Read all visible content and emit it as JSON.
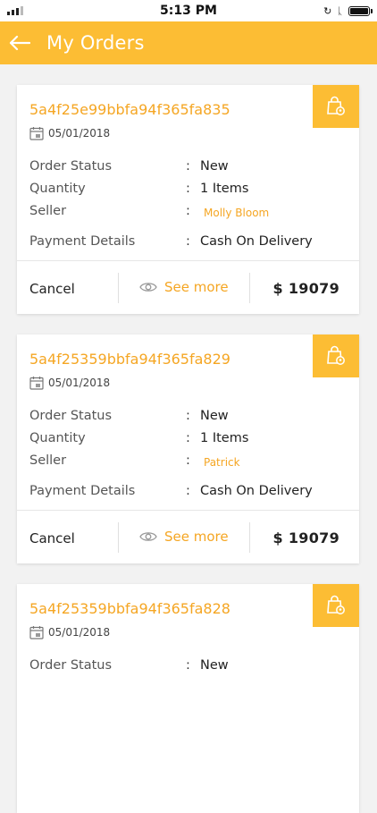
{
  "status_bar": {
    "time": "5:13 PM"
  },
  "header": {
    "title": "My Orders"
  },
  "labels": {
    "order_status": "Order Status",
    "quantity": "Quantity",
    "seller": "Seller",
    "payment": "Payment Details",
    "colon": ":",
    "cancel": "Cancel",
    "see_more": "See more"
  },
  "orders": [
    {
      "id": "5a4f25e99bbfa94f365fa835",
      "date": "05/01/2018",
      "status": "New",
      "quantity": "1 Items",
      "seller": "Molly Bloom",
      "payment": "Cash On Delivery",
      "price": "$ 19079"
    },
    {
      "id": "5a4f25359bbfa94f365fa829",
      "date": "05/01/2018",
      "status": "New",
      "quantity": "1 Items",
      "seller": "Patrick",
      "payment": "Cash On Delivery",
      "price": "$ 19079"
    },
    {
      "id": "5a4f25359bbfa94f365fa828",
      "date": "05/01/2018",
      "status": "New",
      "quantity": "",
      "seller": "",
      "payment": "",
      "price": ""
    }
  ],
  "colors": {
    "accent": "#fcbd34",
    "accent_text": "#f5a623"
  }
}
